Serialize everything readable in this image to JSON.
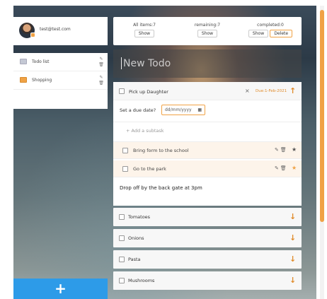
{
  "user": {
    "email": "test@test.com"
  },
  "lists": [
    {
      "label": "Todo list",
      "icon": "list-icon"
    },
    {
      "label": "Shopping",
      "icon": "list-icon"
    }
  ],
  "stats": {
    "all_label": "All items:7",
    "remaining_label": "remaining:7",
    "completed_label": "completed:0",
    "show_label": "Show",
    "delete_label": "Delete"
  },
  "new_todo": {
    "placeholder": "New Todo"
  },
  "expanded_todo": {
    "title": "Pick up Daughter",
    "due": "Due:1-Feb-2021",
    "close": "×",
    "due_prompt": "Set a due date?",
    "date_placeholder": "dd/mm/yyyy",
    "add_subtask": "+ Add a subtask",
    "subtasks": [
      {
        "label": "Bring form to the school",
        "starred": false
      },
      {
        "label": "Go to the park",
        "starred": true
      }
    ],
    "note": "Drop off by the back gate at 3pm"
  },
  "todos": [
    {
      "label": "Tomatoes"
    },
    {
      "label": "Onions"
    },
    {
      "label": "Pasta"
    },
    {
      "label": "Mushrooms"
    }
  ],
  "icons": {
    "up": "↑",
    "down": "↓",
    "plus": "+",
    "edit": "✎",
    "trash": "🗑",
    "star": "★",
    "calendar": "▦"
  },
  "colors": {
    "accent": "#f0a245",
    "primary": "#2d9be8"
  }
}
